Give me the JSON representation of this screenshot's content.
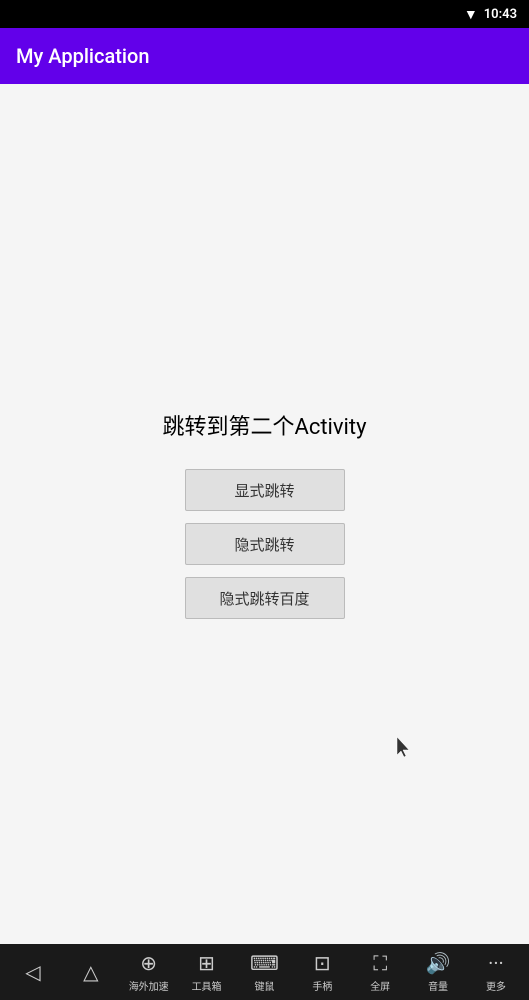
{
  "statusBar": {
    "time": "10:43"
  },
  "appBar": {
    "title": "My Application"
  },
  "main": {
    "heading": "跳转到第二个Activity",
    "buttons": [
      {
        "label": "显式跳转",
        "name": "explicit-jump-button"
      },
      {
        "label": "隐式跳转",
        "name": "implicit-jump-button"
      },
      {
        "label": "隐式跳转百度",
        "name": "implicit-jump-baidu-button"
      }
    ]
  },
  "bottomNav": {
    "items": [
      {
        "icon": "◁",
        "label": ""
      },
      {
        "icon": "△",
        "label": ""
      },
      {
        "icon": "⊕",
        "label": "海外加速"
      },
      {
        "icon": "⊞",
        "label": "工具箱"
      },
      {
        "icon": "⌨",
        "label": "键鼠"
      },
      {
        "icon": "⊡",
        "label": "手柄"
      },
      {
        "icon": "⛶",
        "label": "全屏"
      },
      {
        "icon": "🔊",
        "label": "音量"
      },
      {
        "icon": "···",
        "label": "更多"
      }
    ]
  }
}
